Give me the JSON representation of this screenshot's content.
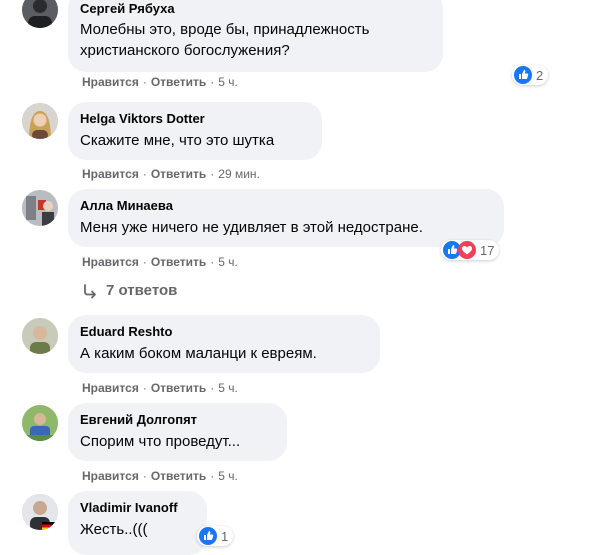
{
  "comments": [
    {
      "author": "Сергей Рябуха",
      "text": "Молебны это, вроде бы, принадлежность\nхристианского богослужения?",
      "like_label": "Нравится",
      "reply_label": "Ответить",
      "time": "5 ч.",
      "reactions": {
        "icons": [
          "like-icon"
        ],
        "count": "2"
      }
    },
    {
      "author": "Helga Viktors Dotter",
      "text": "Скажите мне, что это шутка",
      "like_label": "Нравится",
      "reply_label": "Ответить",
      "time": "29 мин."
    },
    {
      "author": "Алла Минаева",
      "text": "Меня уже ничего не удивляет в этой недостране.",
      "like_label": "Нравится",
      "reply_label": "Ответить",
      "time": "5 ч.",
      "reactions": {
        "icons": [
          "like-icon",
          "love-icon"
        ],
        "count": "17"
      }
    },
    {
      "author": "Eduard Reshto",
      "text": "А каким боком маланци к евреям.",
      "like_label": "Нравится",
      "reply_label": "Ответить",
      "time": "5 ч."
    },
    {
      "author": "Евгений Долгопят",
      "text": "Спорим что проведут...",
      "like_label": "Нравится",
      "reply_label": "Ответить",
      "time": "5 ч."
    },
    {
      "author": "Vladimir Ivanoff",
      "text": "Жесть..(((",
      "reactions": {
        "icons": [
          "like-icon"
        ],
        "count": "1"
      }
    }
  ],
  "replies_link": "7 ответов",
  "colors": {
    "bubble": "#f0f2f5",
    "secondary_text": "#65676b",
    "like_blue": "#1877f2",
    "love_red": "#f33e58"
  }
}
